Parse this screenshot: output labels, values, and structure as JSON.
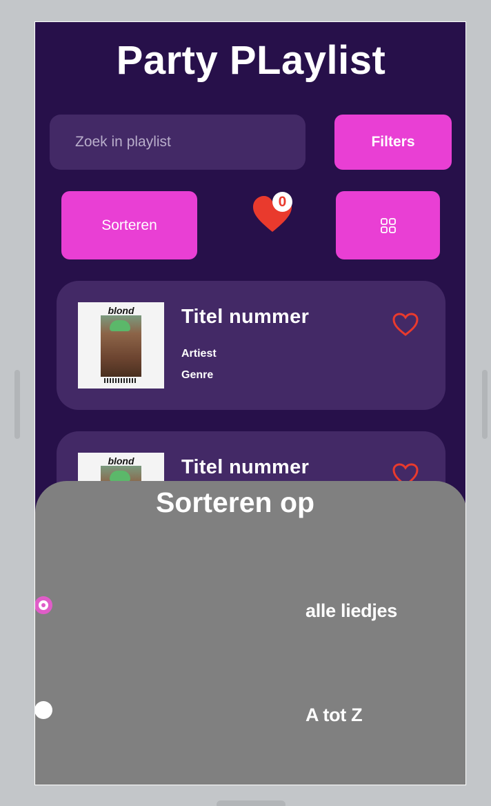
{
  "app": {
    "title": "Party PLaylist"
  },
  "search": {
    "placeholder": "Zoek in playlist"
  },
  "buttons": {
    "filters": "Filters",
    "sort": "Sorteren"
  },
  "favorites": {
    "count": "0"
  },
  "songs": [
    {
      "title": "Titel nummer",
      "artist": "Artiest",
      "genre": "Genre",
      "cover_text": "blond"
    },
    {
      "title": "Titel nummer",
      "cover_text": "blond"
    }
  ],
  "sort_sheet": {
    "title": "Sorteren op",
    "options": [
      {
        "label": "alle liedjes",
        "selected": true
      },
      {
        "label": "A tot Z",
        "selected": false
      }
    ]
  },
  "colors": {
    "background": "#27104a",
    "card": "#432966",
    "accent": "#e93fd4",
    "heart": "#e93a2d",
    "sheet": "#808080"
  }
}
